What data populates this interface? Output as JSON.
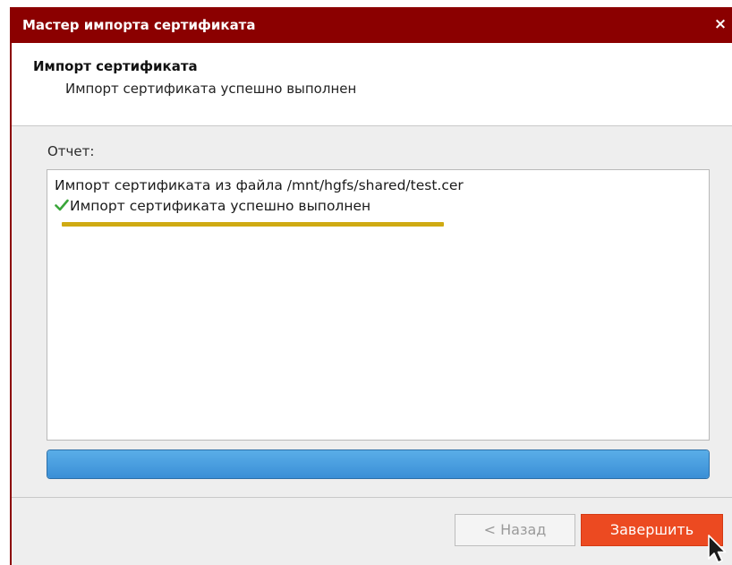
{
  "window": {
    "title": "Мастер импорта сертификата",
    "close_glyph": "×"
  },
  "header": {
    "title": "Импорт сертификата",
    "subtitle": "Импорт сертификата успешно выполнен"
  },
  "report": {
    "label": "Отчет:",
    "lines": [
      {
        "text": "Импорт сертификата из файла /mnt/hgfs/shared/test.cer",
        "icon": null
      },
      {
        "text": "Импорт сертификата успешно выполнен",
        "icon": "checkmark-icon"
      }
    ],
    "highlight_color": "#cfaa12"
  },
  "progress": {
    "percent": 100,
    "fill_color": "#4a9ee0"
  },
  "buttons": {
    "back_label": "< Назад",
    "back_enabled": false,
    "finish_label": "Завершить",
    "finish_color": "#ec4a21"
  },
  "colors": {
    "titlebar": "#8b0000",
    "success_check": "#3aa63a"
  }
}
